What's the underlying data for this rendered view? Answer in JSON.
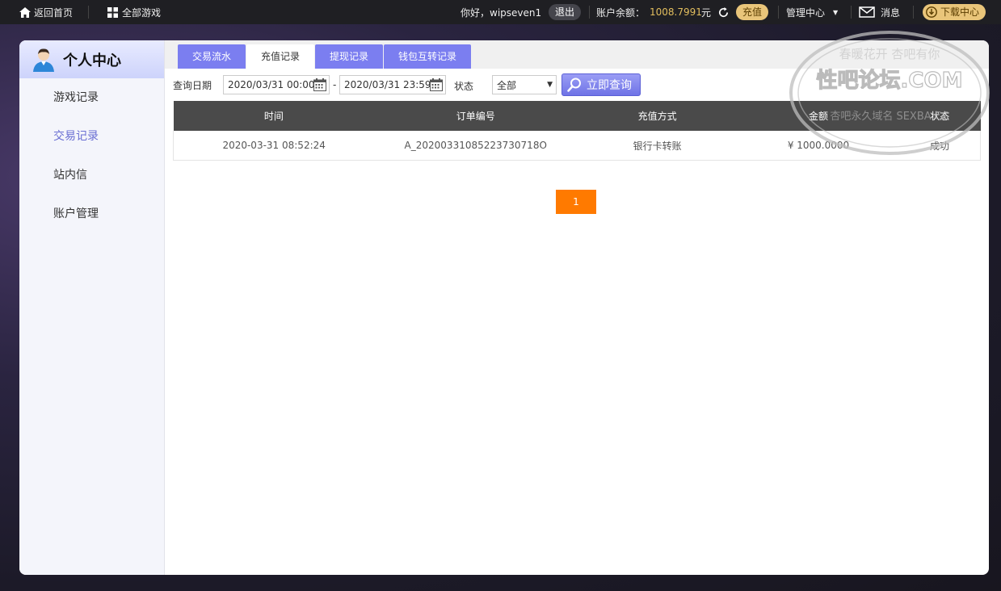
{
  "topbar": {
    "home_label": "返回首页",
    "all_games_label": "全部游戏",
    "greeting": "你好，wipseven1",
    "logout_label": "退出",
    "balance_label": "账户余额：",
    "balance_value": "1008.7991",
    "balance_unit": "元",
    "recharge_label": "充值",
    "manage_label": "管理中心",
    "message_label": "消息",
    "download_label": "下载中心"
  },
  "sidebar": {
    "title": "个人中心",
    "items": [
      {
        "label": "游戏记录"
      },
      {
        "label": "交易记录"
      },
      {
        "label": "站内信"
      },
      {
        "label": "账户管理"
      }
    ]
  },
  "tabs": [
    {
      "label": "交易流水"
    },
    {
      "label": "充值记录"
    },
    {
      "label": "提现记录"
    },
    {
      "label": "钱包互转记录"
    }
  ],
  "filter": {
    "date_label": "查询日期",
    "start_date": "2020/03/31 00:00",
    "end_date": "2020/03/31 23:59",
    "dash": "-",
    "status_label": "状态",
    "status_value": "全部",
    "search_label": "立即查询"
  },
  "table": {
    "headers": [
      "时间",
      "订单编号",
      "充值方式",
      "金额",
      "状态"
    ],
    "rows": [
      [
        "2020-03-31 08:52:24",
        "A_20200331085223730718O",
        "银行卡转账",
        "¥ 1000.0000",
        "成功"
      ]
    ]
  },
  "pagination": {
    "current": "1"
  },
  "watermark": {
    "line1": "春暖花开 杏吧有你",
    "line2": "性吧论坛.COM",
    "line3": "杏吧永久域名 SEXBA.CC"
  },
  "colors": {
    "accent": "#7b7ef0",
    "page_button": "#ff7a00",
    "balance": "#e2be5e",
    "header": "#4a4a4a"
  }
}
